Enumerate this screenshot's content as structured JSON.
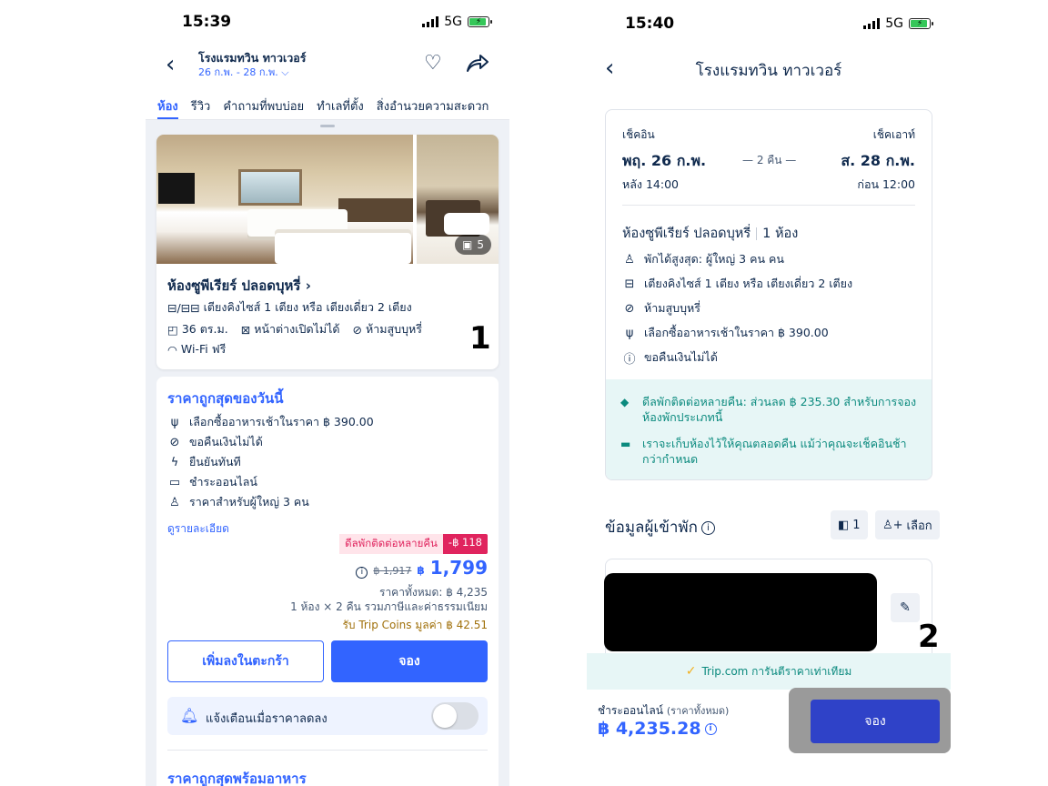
{
  "left_screen": {
    "status": {
      "time": "15:39",
      "network": "5G"
    },
    "header": {
      "title": "โรงแรมทวิน ทาวเวอร์",
      "dates": "26 ก.พ. - 28 ก.พ."
    },
    "tabs": [
      "ห้อง",
      "รีวิว",
      "คำถามที่พบบ่อย",
      "ทำเลที่ตั้ง",
      "สิ่งอำนวยความสะดวก"
    ],
    "room": {
      "photo_count": "5",
      "name": "ห้องซูพีเรียร์ ปลอดบุหรี่",
      "bed_icons": "⊟/⊟⊟",
      "bed": "เตียงคิงไซส์ 1 เตียง หรือ เตียงเดี่ยว 2 เตียง",
      "size": "36 ตร.ม.",
      "window": "หน้าต่างเปิดไม่ได้",
      "smoking": "ห้ามสูบบุหรี่",
      "wifi": "Wi-Fi ฟรี",
      "annotation": "1"
    },
    "offer": {
      "heading": "ราคาถูกสุดของวันนี้",
      "features": [
        "เลือกซื้ออาหารเช้าในราคา ฿ 390.00",
        "ขอคืนเงินไม่ได้",
        "ยืนยันทันที",
        "ชำระออนไลน์",
        "ราคาสำหรับผู้ใหญ่ 3 คน"
      ],
      "details_link": "ดูรายละเอียด",
      "deal_label": "ดีลพักติดต่อหลายคืน",
      "deal_amount": "-฿ 118",
      "old_price": "฿ 1,917",
      "currency": "฿",
      "price": "1,799",
      "total": "ราคาทั้งหมด: ฿ 4,235",
      "total_note": "1 ห้อง × 2 คืน รวมภาษีและค่าธรรมเนียม",
      "coins": "รับ Trip Coins มูลค่า ฿ 42.51",
      "add_cart": "เพิ่มลงในตะกร้า",
      "book": "จอง",
      "alert": "แจ้งเตือนเมื่อราคาลดลง",
      "meal_heading": "ราคาถูกสุดพร้อมอาหาร"
    }
  },
  "right_screen": {
    "status": {
      "time": "15:40",
      "network": "5G"
    },
    "header": {
      "title": "โรงแรมทวิน ทาวเวอร์"
    },
    "booking": {
      "checkin_label": "เช็คอิน",
      "checkout_label": "เช็คเอาท์",
      "checkin_date": "พฤ. 26 ก.พ.",
      "checkout_date": "ส. 28 ก.พ.",
      "nights": "— 2 คืน —",
      "checkin_time": "หลัง 14:00",
      "checkout_time": "ก่อน 12:00",
      "room_name": "ห้องซูพีเรียร์ ปลอดบุหรี่",
      "room_count": "1 ห้อง",
      "features": [
        "พักได้สูงสุด: ผู้ใหญ่ 3 คน คน",
        "เตียงคิงไซส์ 1 เตียง หรือ เตียงเดี่ยว 2 เตียง",
        "ห้ามสูบบุหรี่",
        "เลือกซื้ออาหารเช้าในราคา ฿ 390.00",
        "ขอคืนเงินไม่ได้"
      ],
      "promo_1": "ดีลพักติดต่อหลายคืน: ส่วนลด ฿ 235.30 สำหรับการจองห้องพักประเภทนี้",
      "promo_2": "เราจะเก็บห้องไว้ให้คุณตลอดคืน แม้ว่าคุณจะเช็คอินช้ากว่ากำหนด"
    },
    "guest": {
      "title": "ข้อมูลผู้เข้าพัก",
      "count_chip": "1",
      "select_chip": "เลือก",
      "annotation": "2"
    },
    "guarantee": "Trip.com การันตีราคาเท่าเทียม",
    "footer": {
      "pay_label": "ชำระออนไลน์",
      "pay_sub": "(ราคาทั้งหมด)",
      "amount": "฿ 4,235.28",
      "book": "จอง"
    }
  },
  "colors": {
    "brand_blue": "#3264ff",
    "deal_pink": "#e0245e",
    "teal": "#0b8a7e",
    "dark_book": "#2f42c8"
  }
}
